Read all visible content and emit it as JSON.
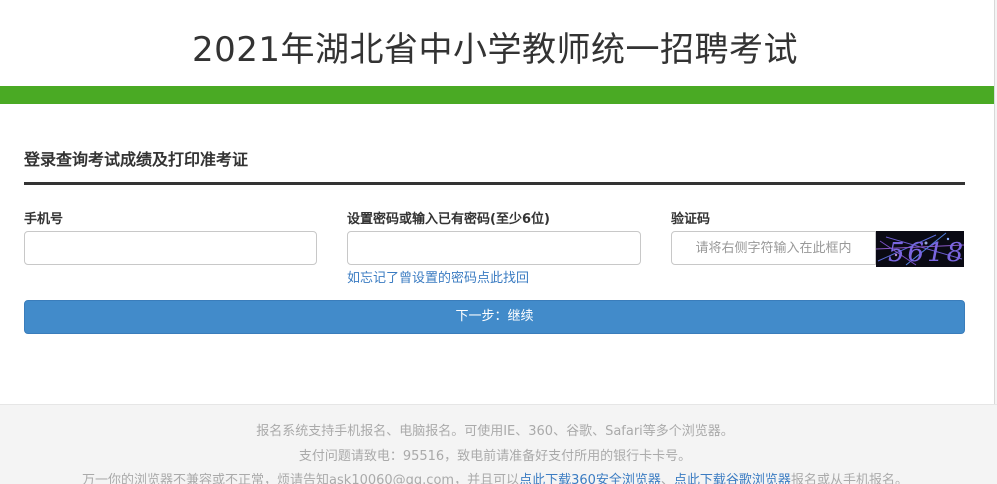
{
  "header": {
    "title": "2021年湖北省中小学教师统一招聘考试"
  },
  "login": {
    "section_title": "登录查询考试成绩及打印准考证",
    "phone_label": "手机号",
    "phone_value": "",
    "password_label": "设置密码或输入已有密码(至少6位)",
    "password_value": "",
    "forgot_link": "如忘记了曾设置的密码点此找回",
    "captcha_label": "验证码",
    "captcha_placeholder": "请将右侧字符输入在此框内",
    "captcha_text": "5618",
    "next_button": "下一步：继续"
  },
  "footer": {
    "line1": "报名系统支持手机报名、电脑报名。可使用IE、360、谷歌、Safari等多个浏览器。",
    "line2": "支付问题请致电：95516，致电前请准备好支付所用的银行卡卡号。",
    "line3_prefix": "万一你的浏览器不兼容或不正常，烦请告知ask10060@qq.com，并且可以",
    "link_360": "点此下载360安全浏览器",
    "separator": "、",
    "link_chrome": "点此下载谷歌浏览器",
    "line3_suffix": "报名或从手机报名。"
  },
  "colors": {
    "brand_green": "#4aaa24",
    "button_blue": "#428bca",
    "link_blue": "#3b7cc2",
    "footer_bg": "#f4f4f4"
  }
}
